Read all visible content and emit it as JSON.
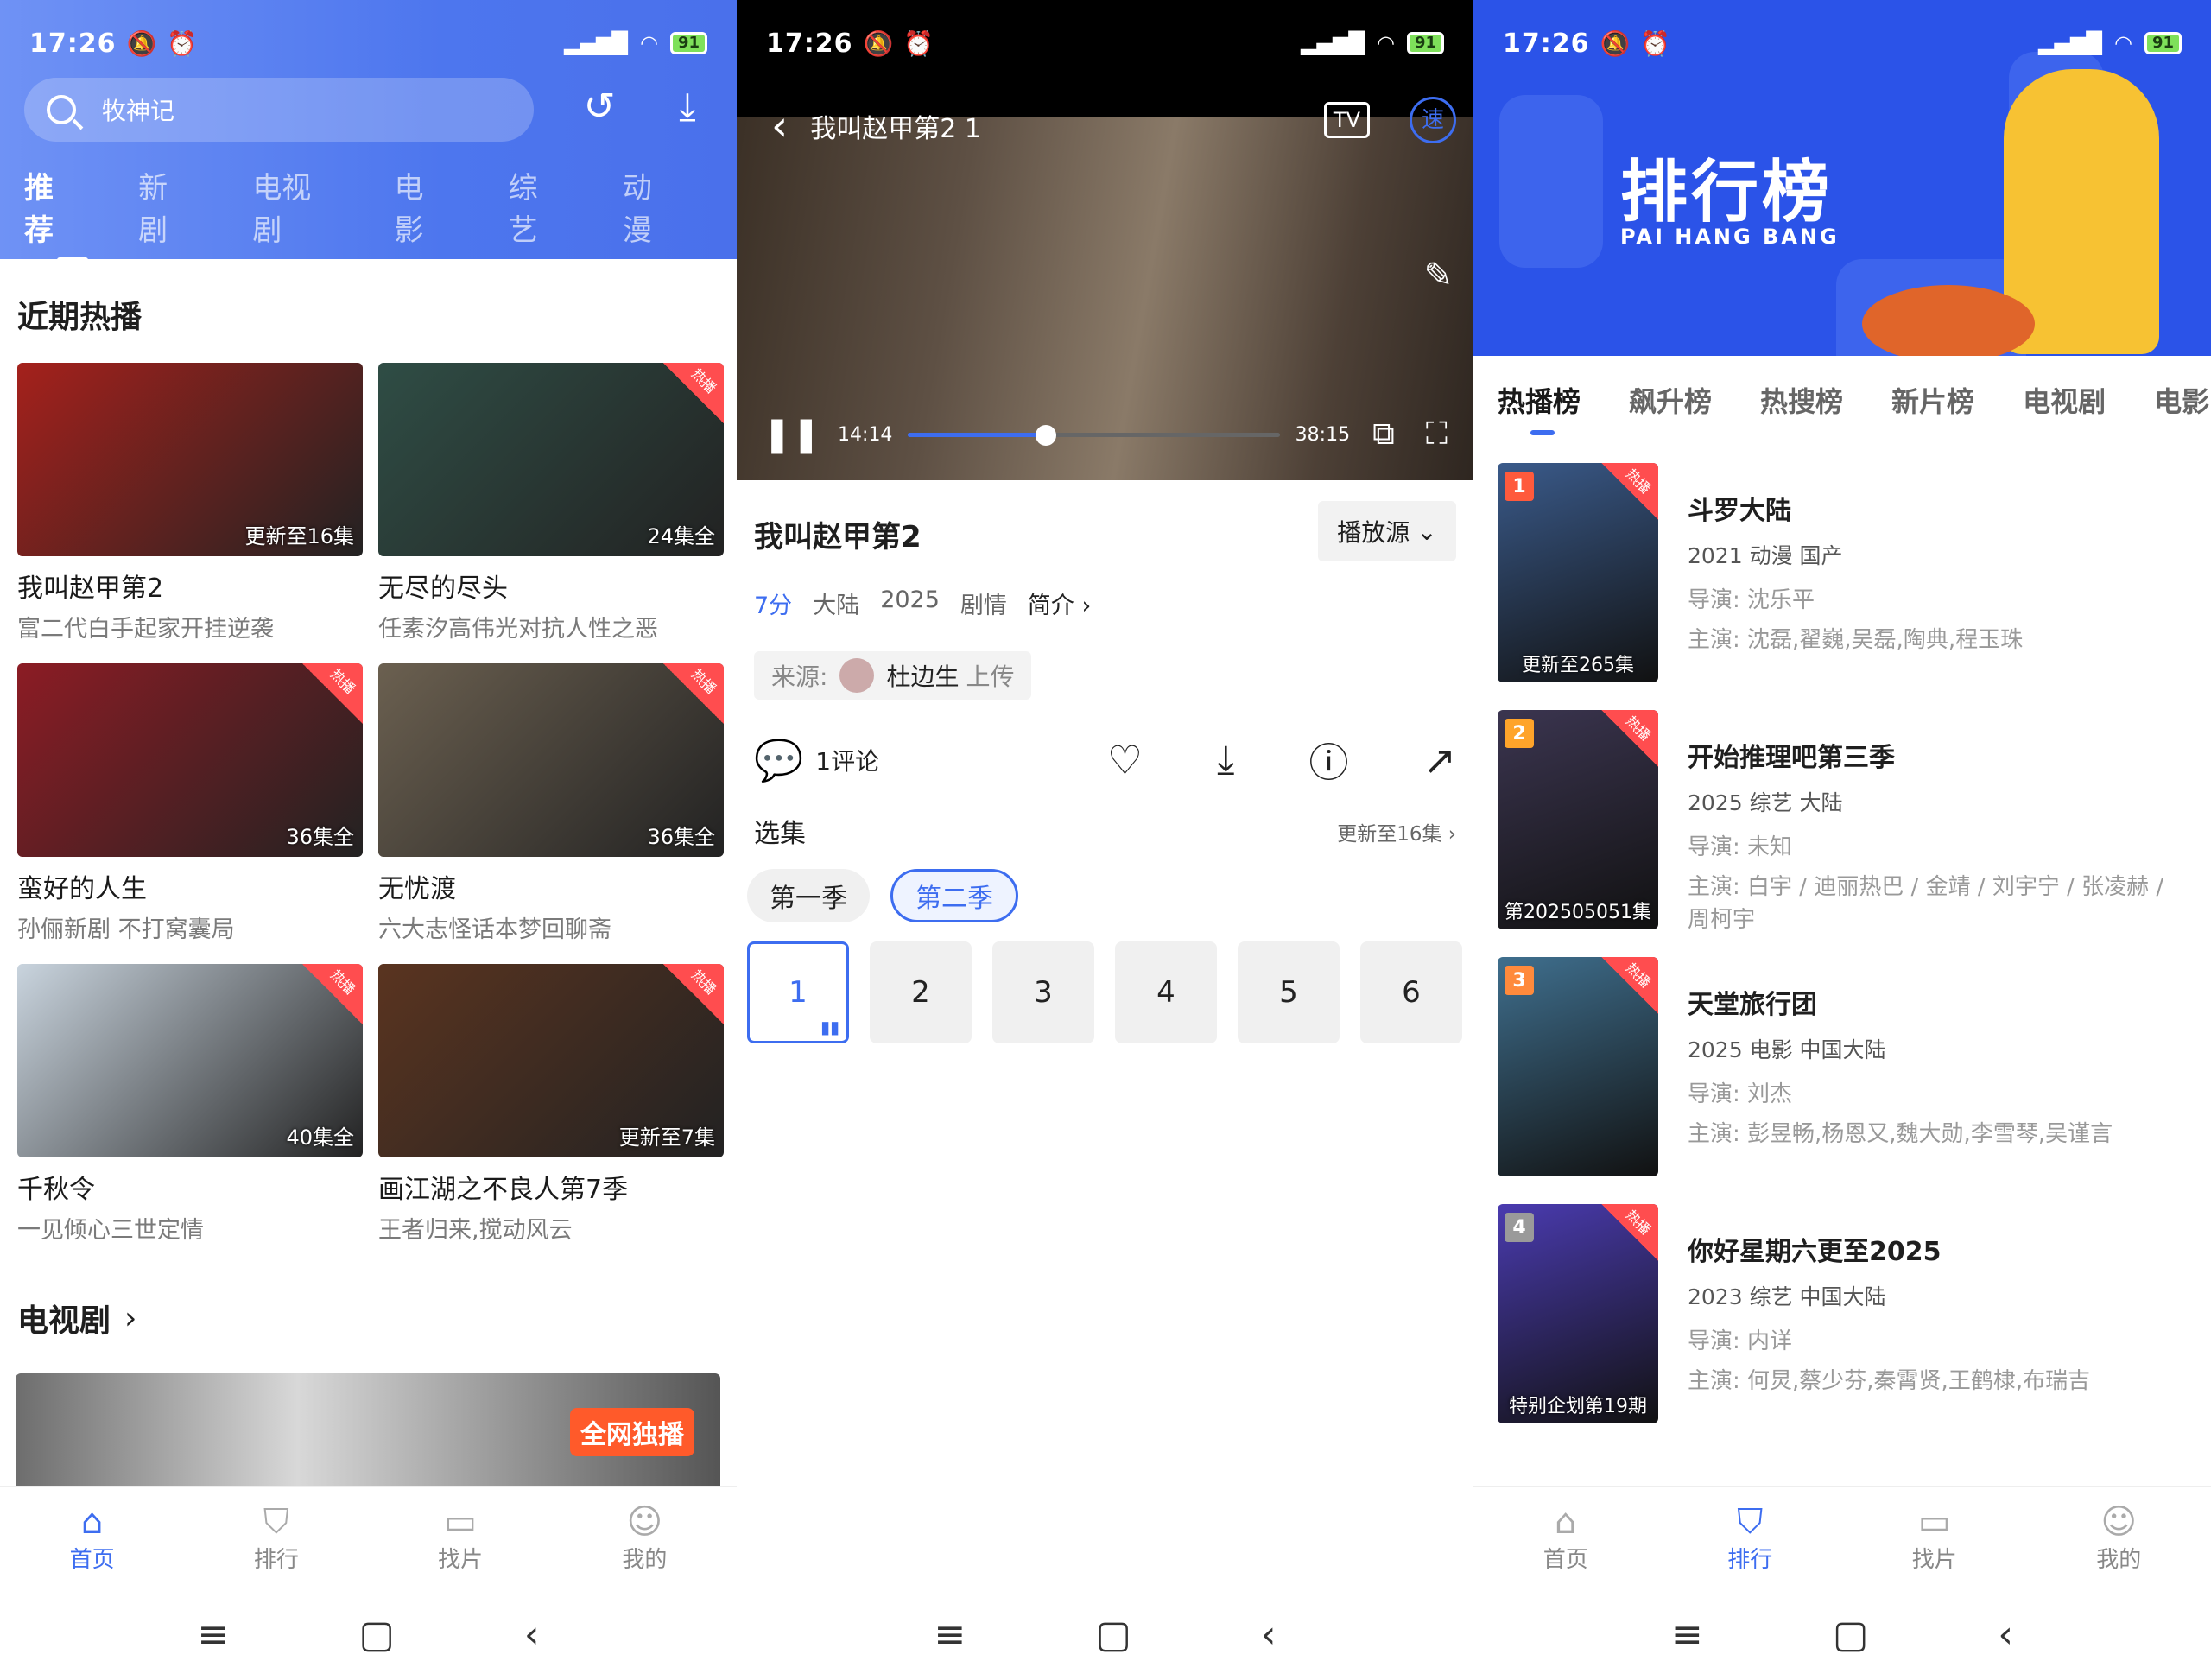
{
  "status": {
    "time": "17:26",
    "battery": "91",
    "signal": "HD"
  },
  "screen1": {
    "search_text": "牧神记",
    "tabs": [
      "推荐",
      "新剧",
      "电视剧",
      "电影",
      "综艺",
      "动漫"
    ],
    "section_hot": "近期热播",
    "cards": [
      {
        "title": "我叫赵甲第2",
        "desc": "富二代白手起家开挂逆袭",
        "ep": "更新至16集",
        "hot": false,
        "color": "#a5211c"
      },
      {
        "title": "无尽的尽头",
        "desc": "任素汐高伟光对抗人性之恶",
        "ep": "24集全",
        "hot": true,
        "color": "#2f4d45"
      },
      {
        "title": "蛮好的人生",
        "desc": "孙俪新剧 不打窝囊局",
        "ep": "36集全",
        "hot": true,
        "color": "#8c1c24"
      },
      {
        "title": "无忧渡",
        "desc": "六大志怪话本梦回聊斋",
        "ep": "36集全",
        "hot": true,
        "color": "#6b6050"
      },
      {
        "title": "千秋令",
        "desc": "一见倾心三世定情",
        "ep": "40集全",
        "hot": true,
        "color": "#c9d4de"
      },
      {
        "title": "画江湖之不良人第7季",
        "desc": "王者归来,搅动风云",
        "ep": "更新至7集",
        "hot": true,
        "color": "#5a3420"
      }
    ],
    "hot_label": "热播",
    "section_tv": "电视剧",
    "tv_banner_tag": "全网独播"
  },
  "screen2": {
    "player_title": "我叫赵甲第2 1",
    "time_current": "14:14",
    "time_total": "38:15",
    "progress": 0.37,
    "title": "我叫赵甲第2",
    "source_button": "播放源",
    "score": "7分",
    "meta": [
      "大陆",
      "2025",
      "剧情"
    ],
    "intro_link": "简介",
    "uploader_label": "来源:",
    "uploader_name": "杜边生",
    "uploader_suffix": "上传",
    "comments": "1评论",
    "episodes_label": "选集",
    "episodes_update": "更新至16集",
    "seasons": [
      "第一季",
      "第二季"
    ],
    "episodes": [
      "1",
      "2",
      "3",
      "4",
      "5",
      "6"
    ]
  },
  "screen3": {
    "banner_title": "排行榜",
    "banner_sub": "PAI HANG BANG",
    "tabs": [
      "热播榜",
      "飙升榜",
      "热搜榜",
      "新片榜",
      "电视剧",
      "电影"
    ],
    "items": [
      {
        "rank": "1",
        "title": "斗罗大陆",
        "meta": "2021  动漫  国产",
        "director": "导演: 沈乐平",
        "cast": "主演: 沈磊,翟巍,吴磊,陶典,程玉珠",
        "ep": "更新至265集",
        "color": "#3a5a8a",
        "rank_color": "#ff5a3c"
      },
      {
        "rank": "2",
        "title": "开始推理吧第三季",
        "meta": "2025  综艺  大陆",
        "director": "导演: 未知",
        "cast": "主演: 白宇 / 迪丽热巴 / 金靖 / 刘宇宁 / 张凌赫 / 周柯宇",
        "ep": "第202505051集",
        "color": "#3b3550",
        "rank_color": "#ffa42a"
      },
      {
        "rank": "3",
        "title": "天堂旅行团",
        "meta": "2025  电影  中国大陆",
        "director": "导演: 刘杰",
        "cast": "主演: 彭昱畅,杨恩又,魏大勋,李雪琴,吴谨言",
        "ep": "",
        "color": "#3f6f8e",
        "rank_color": "#ff8a3c"
      },
      {
        "rank": "4",
        "title": "你好星期六更至2025",
        "meta": "2023  综艺  中国大陆",
        "director": "导演: 内详",
        "cast": "主演: 何炅,蔡少芬,秦霄贤,王鹤棣,布瑞吉",
        "ep": "特别企划第19期",
        "color": "#4a3bb0",
        "rank_color": "#9a9a9a"
      }
    ],
    "hot_label": "热播"
  },
  "nav": {
    "home": "首页",
    "rank": "排行",
    "find": "找片",
    "mine": "我的"
  }
}
